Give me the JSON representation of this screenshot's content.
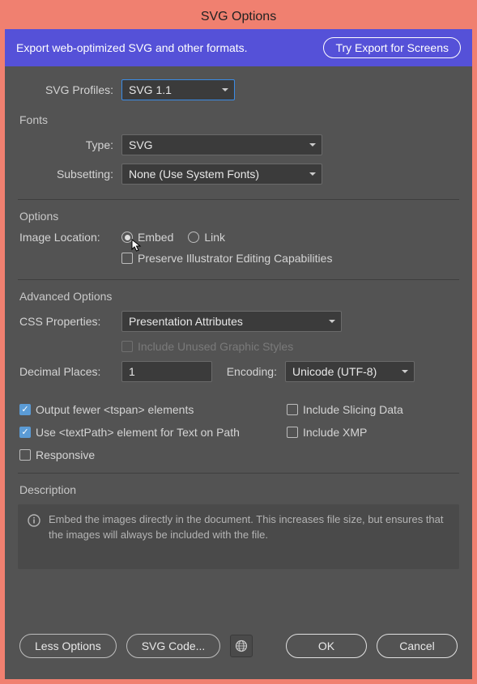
{
  "title": "SVG Options",
  "banner": {
    "text": "Export web-optimized SVG and other formats.",
    "button": "Try Export for Screens"
  },
  "svg_profiles": {
    "label": "SVG Profiles:",
    "value": "SVG 1.1"
  },
  "fonts": {
    "title": "Fonts",
    "type_label": "Type:",
    "type_value": "SVG",
    "subsetting_label": "Subsetting:",
    "subsetting_value": "None (Use System Fonts)"
  },
  "options": {
    "title": "Options",
    "image_location_label": "Image Location:",
    "embed": "Embed",
    "link": "Link",
    "preserve": "Preserve Illustrator Editing Capabilities"
  },
  "advanced": {
    "title": "Advanced Options",
    "css_label": "CSS Properties:",
    "css_value": "Presentation Attributes",
    "unused_styles": "Include Unused Graphic Styles",
    "decimal_label": "Decimal Places:",
    "decimal_value": "1",
    "encoding_label": "Encoding:",
    "encoding_value": "Unicode (UTF-8)",
    "fewer_tspan": "Output fewer <tspan> elements",
    "slicing": "Include Slicing Data",
    "textpath": "Use <textPath> element for Text on Path",
    "xmp": "Include XMP",
    "responsive": "Responsive"
  },
  "description": {
    "title": "Description",
    "text": "Embed the images directly in the document. This increases file size, but ensures that the images will always be included with the file."
  },
  "buttons": {
    "less": "Less Options",
    "svgcode": "SVG Code...",
    "ok": "OK",
    "cancel": "Cancel"
  }
}
